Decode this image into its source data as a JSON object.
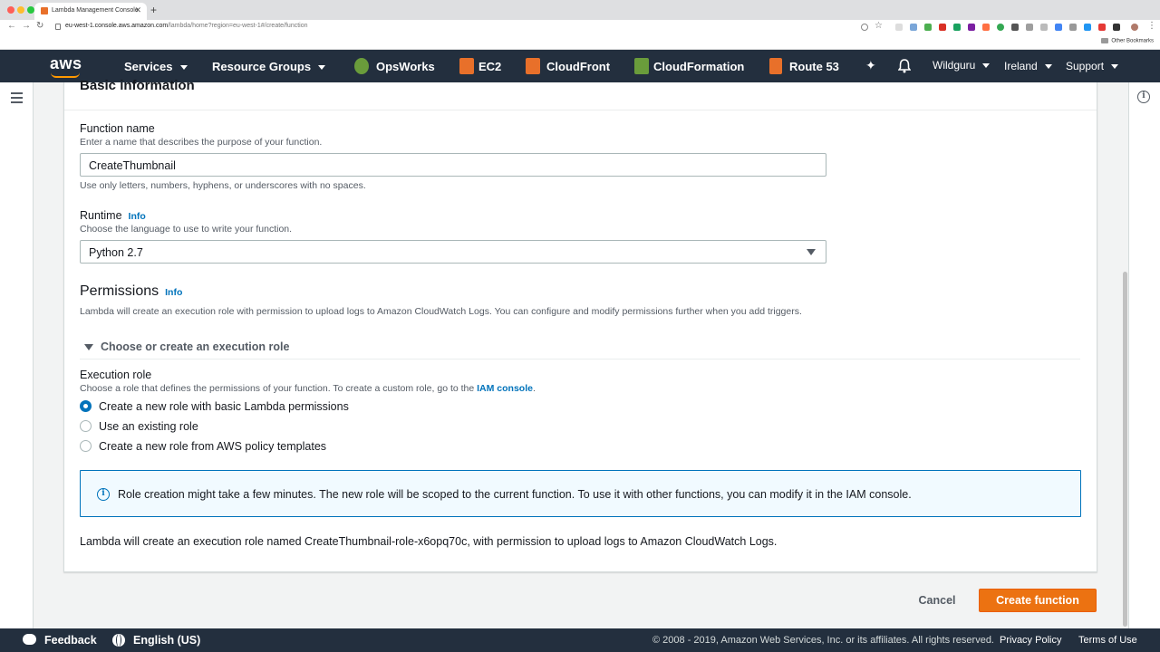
{
  "browser": {
    "tab_title": "Lambda Management Console",
    "url_host": "eu-west-1.console.aws.amazon.com",
    "url_path": "/lambda/home?region=eu-west-1#/create/function",
    "other_bookmarks": "Other Bookmarks"
  },
  "nav": {
    "logo": "aws",
    "services": "Services",
    "resource_groups": "Resource Groups",
    "opsworks": "OpsWorks",
    "ec2": "EC2",
    "cloudfront": "CloudFront",
    "cloudformation": "CloudFormation",
    "route53": "Route 53",
    "account": "Wildguru",
    "region": "Ireland",
    "support": "Support"
  },
  "form": {
    "section_title": "Basic information",
    "function_name": {
      "label": "Function name",
      "description": "Enter a name that describes the purpose of your function.",
      "value": "CreateThumbnail",
      "constraint": "Use only letters, numbers, hyphens, or underscores with no spaces."
    },
    "runtime": {
      "label": "Runtime",
      "info": "Info",
      "description": "Choose the language to use to write your function.",
      "value": "Python 2.7"
    },
    "permissions": {
      "title": "Permissions",
      "info": "Info",
      "description": "Lambda will create an execution role with permission to upload logs to Amazon CloudWatch Logs. You can configure and modify permissions further when you add triggers.",
      "expander": "Choose or create an execution role",
      "execution_role_label": "Execution role",
      "execution_role_desc": "Choose a role that defines the permissions of your function. To create a custom role, go to the ",
      "iam_link": "IAM console",
      "period": ".",
      "options": [
        {
          "label": "Create a new role with basic Lambda permissions",
          "selected": true
        },
        {
          "label": "Use an existing role",
          "selected": false
        },
        {
          "label": "Create a new role from AWS policy templates",
          "selected": false
        }
      ],
      "alert": "Role creation might take a few minutes. The new role will be scoped to the current function. To use it with other functions, you can modify it in the IAM console.",
      "footnote": "Lambda will create an execution role named CreateThumbnail-role-x6opq70c, with permission to upload logs to Amazon CloudWatch Logs."
    }
  },
  "actions": {
    "cancel": "Cancel",
    "create": "Create function"
  },
  "footer": {
    "feedback": "Feedback",
    "language": "English (US)",
    "copyright": "© 2008 - 2019, Amazon Web Services, Inc. or its affiliates. All rights reserved.",
    "privacy": "Privacy Policy",
    "terms": "Terms of Use"
  },
  "colors": {
    "nav_bg": "#232f3e",
    "accent_orange": "#ec7211",
    "link_blue": "#0073bb"
  }
}
